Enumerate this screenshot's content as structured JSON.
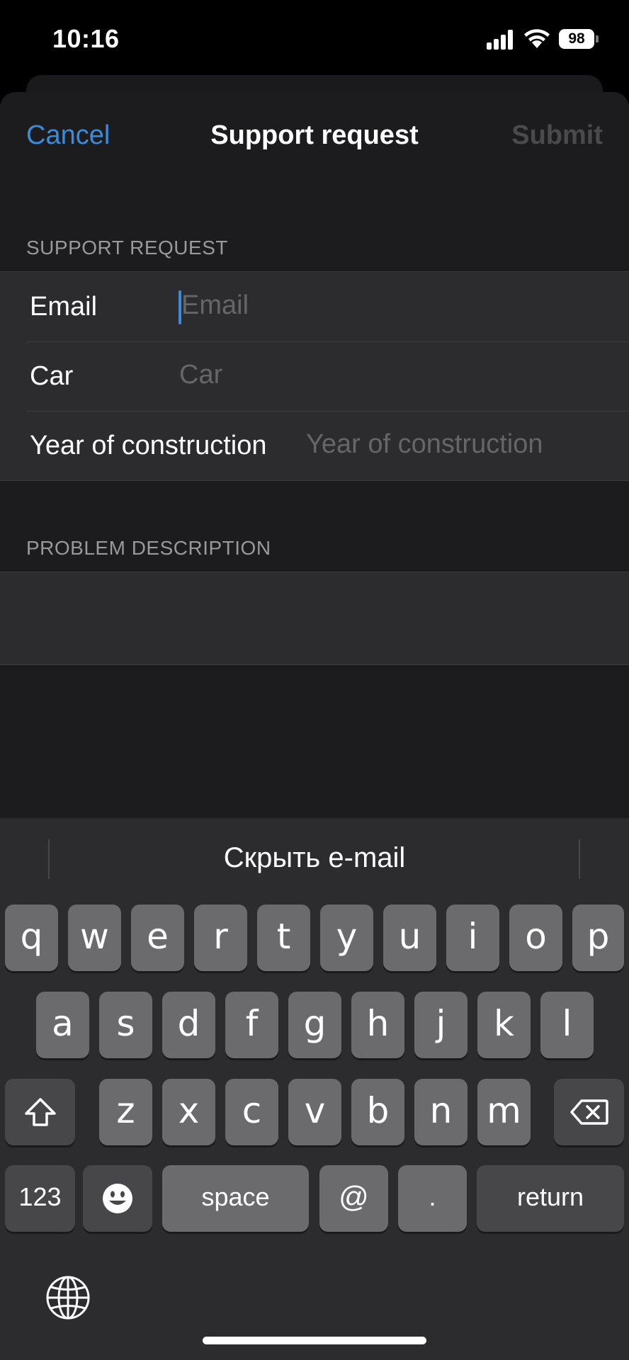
{
  "status_bar": {
    "time": "10:16",
    "battery": "98"
  },
  "nav": {
    "cancel": "Cancel",
    "title": "Support request",
    "submit": "Submit"
  },
  "support_section": {
    "header": "SUPPORT REQUEST",
    "fields": [
      {
        "label": "Email",
        "placeholder": "Email"
      },
      {
        "label": "Car",
        "placeholder": "Car"
      },
      {
        "label": "Year of construction",
        "placeholder": "Year of construction"
      }
    ]
  },
  "problem_section": {
    "header": "PROBLEM DESCRIPTION",
    "text": ""
  },
  "keyboard": {
    "suggestion": "Скрыть e-mail",
    "row1": [
      "q",
      "w",
      "e",
      "r",
      "t",
      "y",
      "u",
      "i",
      "o",
      "p"
    ],
    "row2": [
      "a",
      "s",
      "d",
      "f",
      "g",
      "h",
      "j",
      "k",
      "l"
    ],
    "row3": [
      "z",
      "x",
      "c",
      "v",
      "b",
      "n",
      "m"
    ],
    "numbers": "123",
    "space": "space",
    "at": "@",
    "dot": ".",
    "return": "return",
    "icons": {
      "shift": "shift-icon",
      "delete": "backspace-icon",
      "emoji": "emoji-icon",
      "globe": "globe-icon"
    }
  },
  "colors": {
    "accent": "#3b8bd9",
    "sheet": "#1c1c1e",
    "cell": "#2c2c2e",
    "key": "#6b6b6d",
    "key_dark": "#474749"
  }
}
